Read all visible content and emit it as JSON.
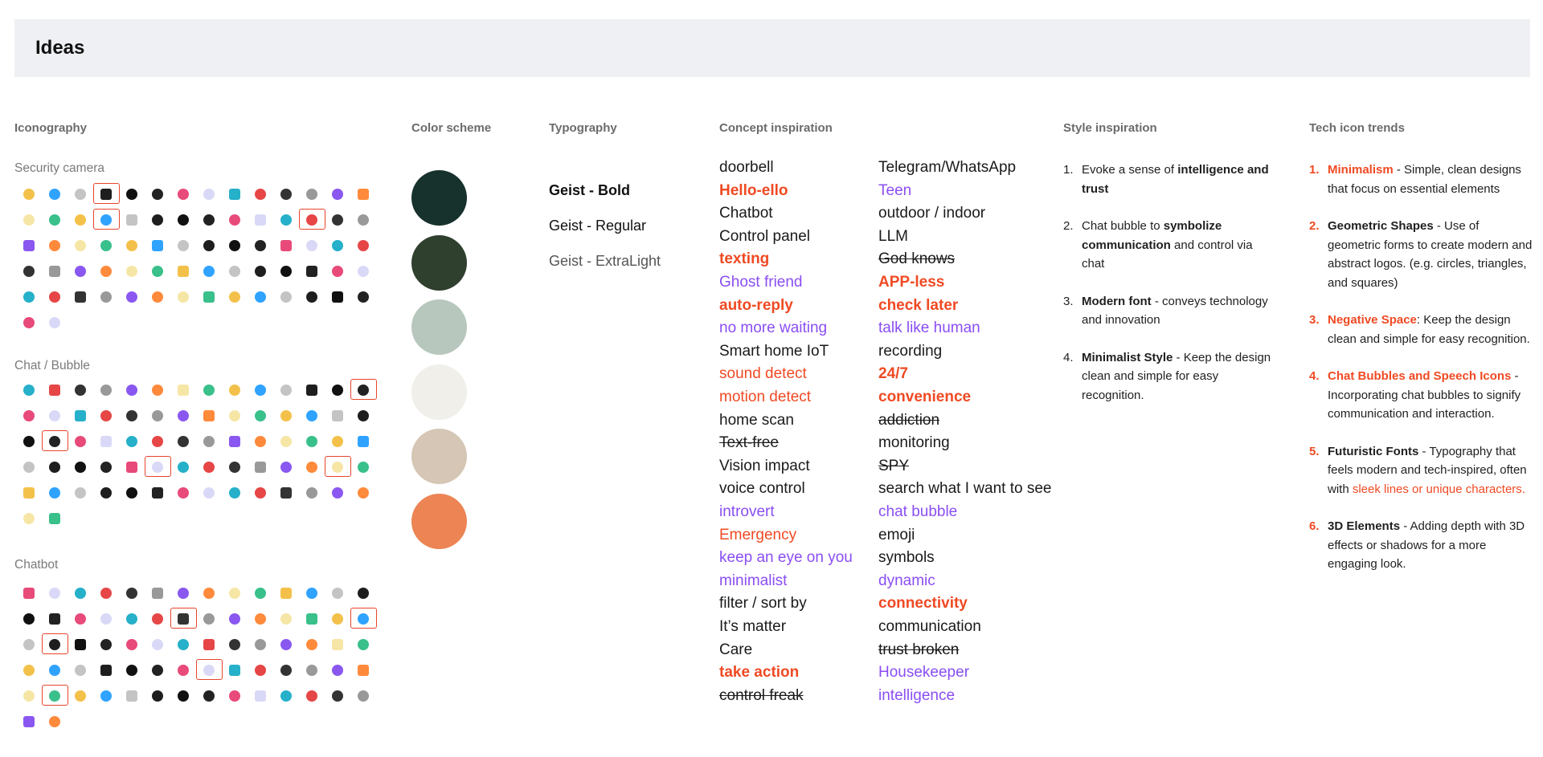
{
  "page": {
    "title": "Ideas"
  },
  "headings": {
    "iconography": "Iconography",
    "color_scheme": "Color scheme",
    "typography": "Typography",
    "concept": "Concept inspiration",
    "style": "Style inspiration",
    "tech": "Tech icon trends"
  },
  "iconography": {
    "groups": [
      {
        "label": "Security camera"
      },
      {
        "label": "Chat / Bubble"
      },
      {
        "label": "Chatbot"
      }
    ]
  },
  "colors": [
    "#17312c",
    "#2f402e",
    "#b8c7bd",
    "#f1efea",
    "#d5c6b5",
    "#ec8453"
  ],
  "typography": [
    "Geist - Bold",
    "Geist - Regular",
    "Geist - ExtraLight"
  ],
  "concepts": {
    "col1": [
      {
        "t": "doorbell",
        "s": "black"
      },
      {
        "t": "Hello-ello",
        "s": "red-bold"
      },
      {
        "t": "Chatbot",
        "s": "black"
      },
      {
        "t": "Control panel",
        "s": "black"
      },
      {
        "t": "texting",
        "s": "red-bold"
      },
      {
        "t": "Ghost friend",
        "s": "purple"
      },
      {
        "t": "auto-reply",
        "s": "red-bold"
      },
      {
        "t": "no more waiting",
        "s": "purple"
      },
      {
        "t": "Smart home IoT",
        "s": "black"
      },
      {
        "t": "sound detect",
        "s": "red"
      },
      {
        "t": "motion detect",
        "s": "red"
      },
      {
        "t": "home scan",
        "s": "black"
      },
      {
        "t": "Text-free",
        "s": "strike"
      },
      {
        "t": "Vision impact",
        "s": "black"
      },
      {
        "t": "voice control",
        "s": "black"
      },
      {
        "t": "introvert",
        "s": "purple"
      },
      {
        "t": "Emergency",
        "s": "red"
      },
      {
        "t": "keep an eye on you",
        "s": "purple"
      },
      {
        "t": "minimalist",
        "s": "purple"
      },
      {
        "t": "filter / sort by",
        "s": "black"
      },
      {
        "t": "It’s matter",
        "s": "black"
      },
      {
        "t": "Care",
        "s": "black"
      },
      {
        "t": "take action",
        "s": "red-bold"
      },
      {
        "t": "control freak",
        "s": "strike"
      }
    ],
    "col2": [
      {
        "t": "Telegram/WhatsApp",
        "s": "black"
      },
      {
        "t": "Teen",
        "s": "purple"
      },
      {
        "t": "outdoor / indoor",
        "s": "black"
      },
      {
        "t": "LLM",
        "s": "black"
      },
      {
        "t": "God knows",
        "s": "strike"
      },
      {
        "t": "APP-less",
        "s": "red-bold"
      },
      {
        "t": "check later",
        "s": "red-bold"
      },
      {
        "t": "talk like human",
        "s": "purple"
      },
      {
        "t": "recording",
        "s": "black"
      },
      {
        "t": "24/7",
        "s": "red-bold"
      },
      {
        "t": "convenience",
        "s": "red-bold"
      },
      {
        "t": "addiction",
        "s": "strike"
      },
      {
        "t": "monitoring",
        "s": "black"
      },
      {
        "t": "SPY",
        "s": "strike"
      },
      {
        "t": "search what I want to see",
        "s": "black"
      },
      {
        "t": "chat bubble",
        "s": "purple"
      },
      {
        "t": "emoji",
        "s": "black"
      },
      {
        "t": "symbols",
        "s": "black"
      },
      {
        "t": "dynamic",
        "s": "purple"
      },
      {
        "t": "connectivity",
        "s": "red-bold"
      },
      {
        "t": "communication",
        "s": "black"
      },
      {
        "t": "trust broken",
        "s": "strike"
      },
      {
        "t": "Housekeeper",
        "s": "purple"
      },
      {
        "t": "intelligence",
        "s": "purple"
      }
    ]
  },
  "style": [
    {
      "n": "1.",
      "a": "Evoke a sense of ",
      "b": "intelligence and trust",
      "c": ""
    },
    {
      "n": "2.",
      "a": "Chat bubble to ",
      "b": "symbolize communication",
      "c": " and control via chat"
    },
    {
      "n": "3.",
      "a": "",
      "b": "Modern font",
      "c": " - conveys technology and innovation"
    },
    {
      "n": "4.",
      "a": "",
      "b": "Minimalist Style",
      "c": " - Keep the design clean and simple for easy recognition."
    }
  ],
  "trends": [
    {
      "n": "1.",
      "title": "Minimalism",
      "title_red": true,
      "rest": " - Simple, clean designs that focus on essential elements",
      "extra": ""
    },
    {
      "n": "2.",
      "title": "Geometric Shapes",
      "title_red": false,
      "rest": " - Use of geometric forms to create modern and abstract logos. (e.g. circles, triangles, and squares)",
      "extra": ""
    },
    {
      "n": "3.",
      "title": "Negative Space",
      "title_red": true,
      "rest": ": Keep the design clean and simple for easy recognition.",
      "extra": ""
    },
    {
      "n": "4.",
      "title": "Chat Bubbles and Speech Icons",
      "title_red": true,
      "rest": " - Incorporating chat bubbles to signify communication and interaction.",
      "extra": ""
    },
    {
      "n": "5.",
      "title": "Futuristic Fonts",
      "title_red": false,
      "rest": " - Typography that feels modern and tech-inspired, often with ",
      "extra": "sleek lines or unique characters."
    },
    {
      "n": "6.",
      "title": "3D Elements",
      "title_red": false,
      "rest": " - Adding depth with 3D effects or shadows for a more engaging look.",
      "extra": ""
    }
  ]
}
